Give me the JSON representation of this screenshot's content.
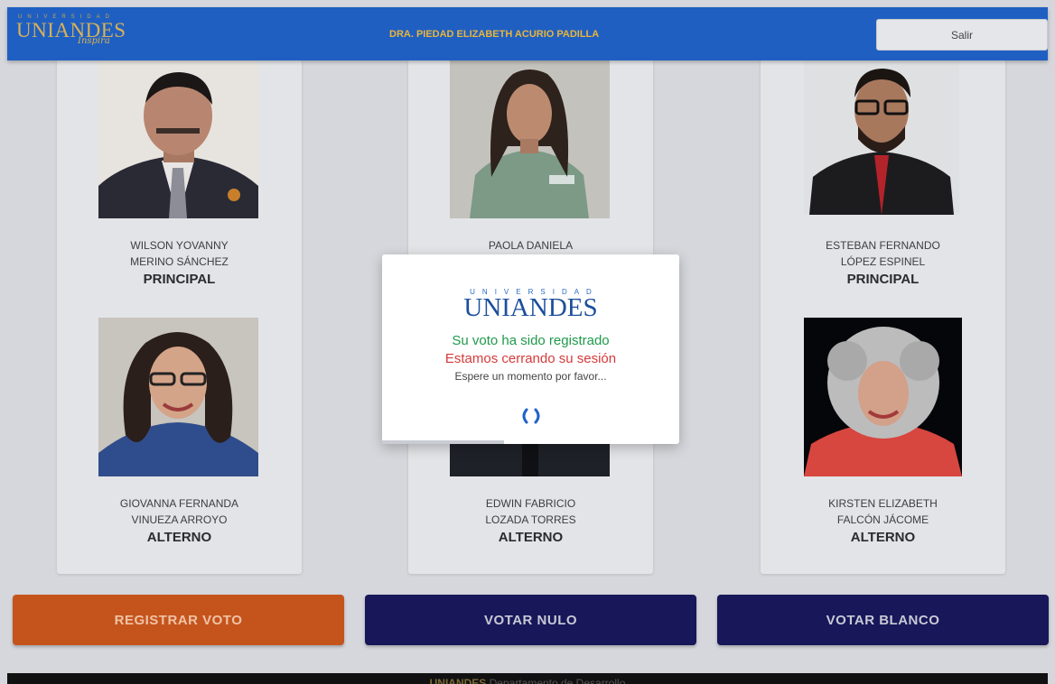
{
  "header": {
    "logo_small": "UNIVERSIDAD",
    "logo_main": "UNIANDES",
    "logo_tagline": "Inspira",
    "user_name": "DRA. PIEDAD ELIZABETH ACURIO PADILLA",
    "exit_label": "Salir"
  },
  "candidates": {
    "principal_1": {
      "line1": "WILSON YOVANNY",
      "line2": "MERINO SÁNCHEZ",
      "role": "PRINCIPAL"
    },
    "principal_2": {
      "line1": "PAOLA DANIELA"
    },
    "principal_3": {
      "line1": "ESTEBAN FERNANDO",
      "line2": "LÓPEZ ESPINEL",
      "role": "PRINCIPAL"
    },
    "alterno_1": {
      "line1": "GIOVANNA FERNANDA",
      "line2": "VINUEZA ARROYO",
      "role": "ALTERNO"
    },
    "alterno_2": {
      "line1": "EDWIN FABRICIO",
      "line2": "LOZADA TORRES",
      "role": "ALTERNO"
    },
    "alterno_3": {
      "line1": "KIRSTEN ELIZABETH",
      "line2": "FALCÓN JÁCOME",
      "role": "ALTERNO"
    }
  },
  "actions": {
    "register_label": "REGISTRAR VOTO",
    "null_label": "VOTAR NULO",
    "blank_label": "VOTAR BLANCO"
  },
  "footer": {
    "brand": "UNIANDES",
    "text": "Departamento de Desarrollo"
  },
  "modal": {
    "logo_small": "UNIVERSIDAD",
    "logo_main": "UNIANDES",
    "line1": "Su voto ha sido registrado",
    "line2": "Estamos cerrando su sesión",
    "line3": "Espere un momento por favor...",
    "spinner_icon": "loading-spinner-icon"
  },
  "colors": {
    "header_bg": "#1f5fc2",
    "accent_gold": "#d8b157",
    "register_btn": "#c5541c",
    "vote_btn": "#17175a",
    "success_text": "#1f9a4a",
    "warning_text": "#d63a3a"
  }
}
